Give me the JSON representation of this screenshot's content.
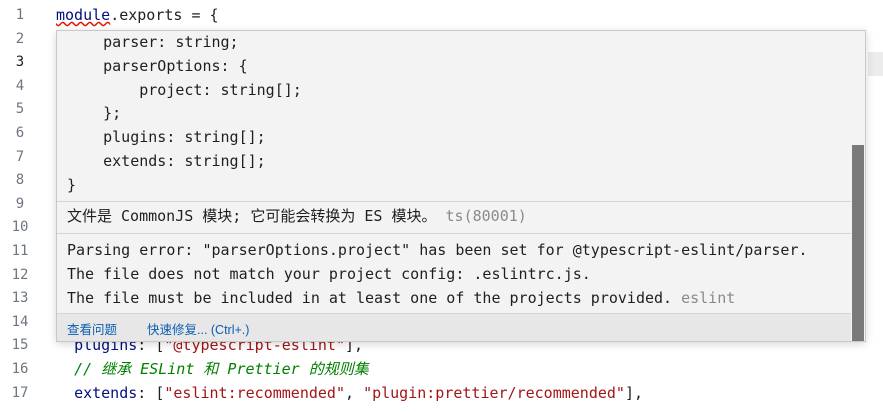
{
  "gutter": {
    "line_numbers": [
      "1",
      "2",
      "3",
      "4",
      "5",
      "6",
      "7",
      "8",
      "9",
      "10",
      "11",
      "12",
      "13",
      "14",
      "15",
      "16",
      "17"
    ]
  },
  "editor": {
    "line1": {
      "module": "module",
      "exports": ".exports = {"
    },
    "line15": {
      "key": "plugins",
      "rest": ": [\"@typescript-eslint\"],",
      "string": "\"@typescript-eslint\""
    },
    "line16": {
      "comment": "// 继承 ESLint 和 Prettier 的规则集"
    },
    "line17": {
      "key": "extends",
      "colon": ": [",
      "str1": "\"eslint:recommended\"",
      "comma": ", ",
      "str2": "\"plugin:prettier/recommended\"",
      "end": "],"
    }
  },
  "hover": {
    "type_lines": [
      "    parser: string;",
      "    parserOptions: {",
      "        project: string[];",
      "    };",
      "    plugins: string[];",
      "    extends: string[];",
      "}"
    ],
    "ts_message": "文件是 CommonJS 模块; 它可能会转换为 ES 模块。",
    "ts_code": "ts(80001)",
    "eslint_lines": [
      "Parsing error: \"parserOptions.project\" has been set for @typescript-eslint/parser.",
      "The file does not match your project config: .eslintrc.js.",
      "The file must be included in at least one of the projects provided."
    ],
    "eslint_source": "eslint",
    "actions": {
      "view_problem": "查看问题",
      "quick_fix": "快速修复... (Ctrl+.)"
    }
  }
}
